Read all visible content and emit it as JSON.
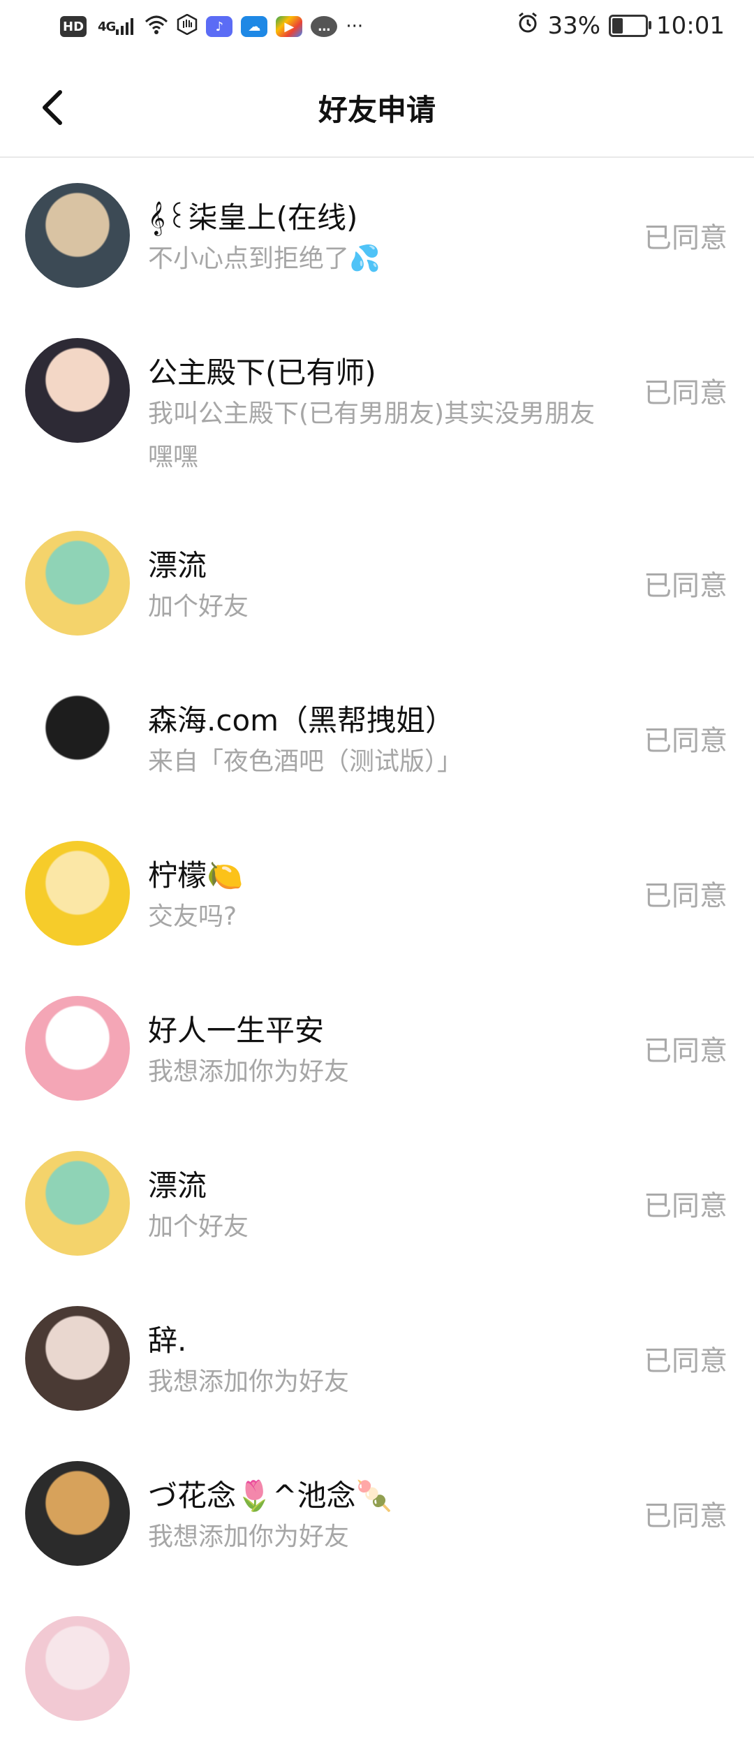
{
  "status_bar": {
    "hd": "HD",
    "network": "4G",
    "battery_percent": "33%",
    "time": "10:01",
    "battery_level": 0.33,
    "icons": [
      "hd-icon",
      "signal-icon",
      "wifi-icon",
      "hand-icon",
      "music-app-icon",
      "weather-app-icon",
      "play-app-icon",
      "chat-app-icon",
      "more-icon",
      "alarm-icon",
      "battery-icon"
    ],
    "more": "···"
  },
  "header": {
    "title": "好友申请",
    "back_icon": "chevron-left-icon"
  },
  "requests": [
    {
      "name": "𝄞꒰柒皇上(在线)",
      "message": "不小心点到拒绝了💦",
      "status": "已同意",
      "avatar_colors": [
        "#3c4a55",
        "#d9c3a3"
      ]
    },
    {
      "name": "公主殿下(已有师)",
      "message": "我叫公主殿下(已有男朋友)其实没男朋友嘿嘿",
      "status": "已同意",
      "avatar_colors": [
        "#2d2a35",
        "#f3d7c6"
      ]
    },
    {
      "name": "漂流",
      "message": "加个好友",
      "status": "已同意",
      "avatar_colors": [
        "#f4d36b",
        "#8fd3b6"
      ]
    },
    {
      "name": "森海.com（黑帮拽姐）",
      "message": "来自「夜色酒吧（测试版）」",
      "status": "已同意",
      "avatar_colors": [
        "#ffffff",
        "#1d1d1d"
      ]
    },
    {
      "name": "柠檬🍋",
      "message": "交友吗?",
      "status": "已同意",
      "avatar_colors": [
        "#f6cc2a",
        "#fbe7a6"
      ]
    },
    {
      "name": "好人一生平安",
      "message": "我想添加你为好友",
      "status": "已同意",
      "avatar_colors": [
        "#f4a6b6",
        "#ffffff"
      ]
    },
    {
      "name": "漂流",
      "message": "加个好友",
      "status": "已同意",
      "avatar_colors": [
        "#f4d36b",
        "#8fd3b6"
      ]
    },
    {
      "name": "辞.",
      "message": "我想添加你为好友",
      "status": "已同意",
      "avatar_colors": [
        "#4a3a34",
        "#e9d7cf"
      ]
    },
    {
      "name": "づ花念🌷^池念🍡",
      "message": "我想添加你为好友",
      "status": "已同意",
      "avatar_colors": [
        "#2b2b2b",
        "#d7a25b"
      ]
    },
    {
      "name": "",
      "message": "",
      "status": "",
      "avatar_colors": [
        "#f2c9d3",
        "#f7e6ea"
      ]
    }
  ]
}
